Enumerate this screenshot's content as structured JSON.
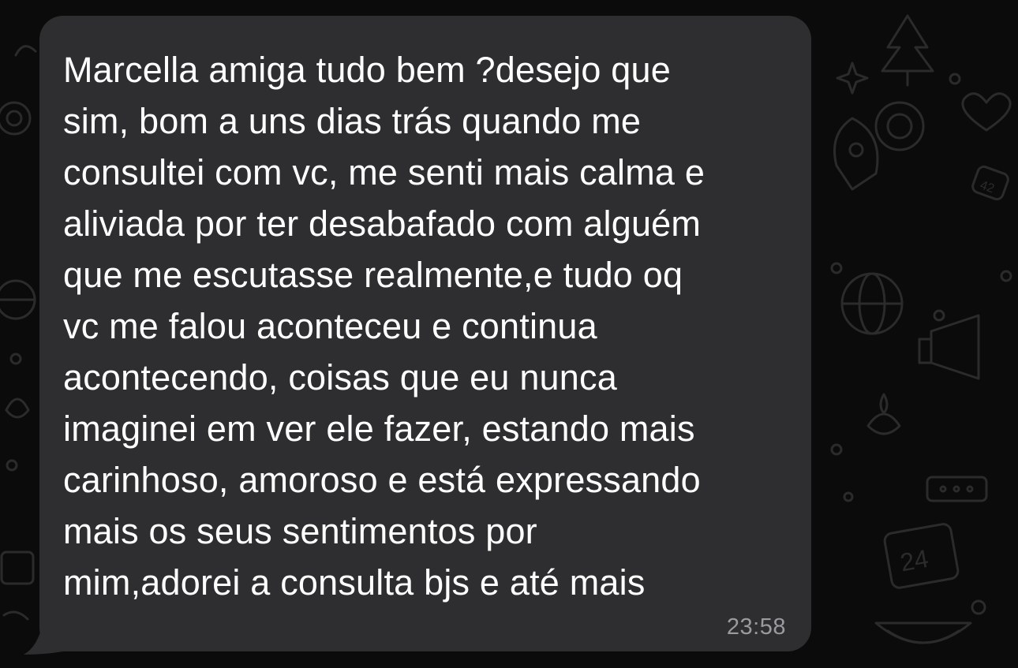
{
  "conversation": {
    "message": {
      "lines": [
        "Marcella amiga tudo bem ?desejo que",
        "sim, bom a uns dias trás quando me",
        "consultei com vc, me senti mais calma e",
        "aliviada por ter desabafado com alguém",
        "que me escutasse realmente,e tudo oq",
        "vc me falou aconteceu e continua",
        "acontecendo, coisas que eu nunca",
        "imaginei em ver ele fazer, estando mais",
        "carinhoso, amoroso e está expressando",
        "mais os seus sentimentos por",
        "mim,adorei a consulta bjs e até mais"
      ],
      "time": "23:58",
      "direction": "incoming"
    },
    "wallpaper": {
      "icons": [
        "rocket-icon",
        "globe-icon",
        "heart-icon",
        "calendar-24-icon",
        "sparkle-icon",
        "megaphone-icon",
        "candle-icon",
        "tree-icon",
        "cake-icon",
        "watermelon-icon",
        "target-icon",
        "badge-42-icon"
      ],
      "calendar_label": "24",
      "badge_label": "42"
    },
    "colors": {
      "background": "#0b0b0b",
      "bubble": "#2e2e30",
      "text": "#ffffff",
      "time": "#9b9b9f",
      "doodle": "#2a2a2a"
    }
  }
}
